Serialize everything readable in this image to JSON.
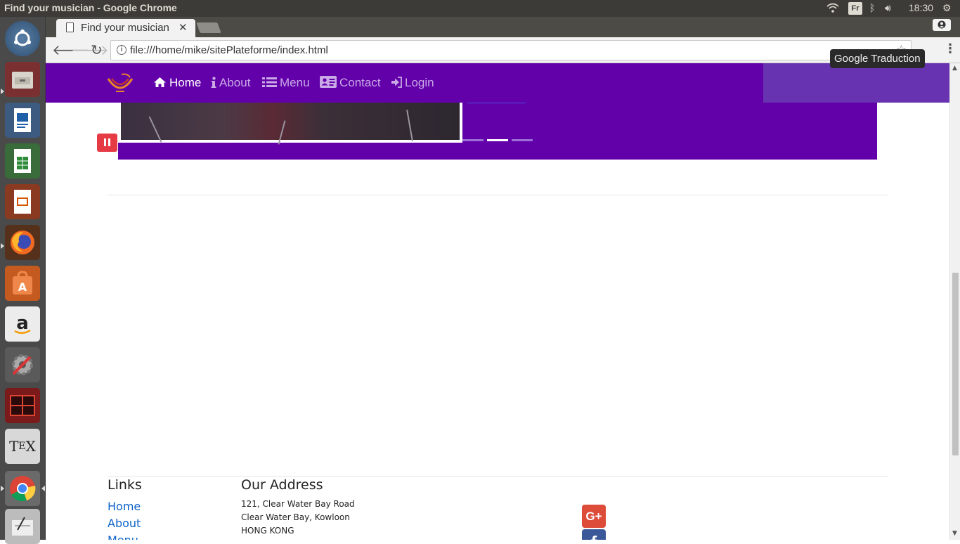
{
  "os": {
    "window_title": "Find your musician - Google Chrome",
    "clock": "18:30",
    "keyboard_layout": "Fr"
  },
  "browser": {
    "tab_title": "Find your musician",
    "url": "file:///home/mike/sitePlateforme/index.html",
    "tooltip": "Google Traduction"
  },
  "site": {
    "nav": [
      {
        "label": "Home",
        "icon": "home-icon",
        "active": true
      },
      {
        "label": "About",
        "icon": "info-icon",
        "active": false
      },
      {
        "label": "Menu",
        "icon": "list-icon",
        "active": false
      },
      {
        "label": "Contact",
        "icon": "address-card-icon",
        "active": false
      },
      {
        "label": "Login",
        "icon": "sign-in-icon",
        "active": false
      }
    ],
    "carousel": {
      "indicator_count": 3,
      "active_indicator": 2
    },
    "footer": {
      "links_heading": "Links",
      "links": [
        "Home",
        "About",
        "Menu"
      ],
      "address_heading": "Our Address",
      "address_lines": [
        "121, Clear Water Bay Road",
        "Clear Water Bay, Kowloon",
        "HONG KONG"
      ],
      "social": [
        {
          "name": "google-plus",
          "glyph": "G+",
          "color": "#dd4b39"
        },
        {
          "name": "facebook",
          "glyph": "f",
          "color": "#3b5998"
        }
      ]
    },
    "colors": {
      "navbar": "#6200aa",
      "accent_link": "#0d63c8",
      "pause": "#e63a45"
    }
  }
}
